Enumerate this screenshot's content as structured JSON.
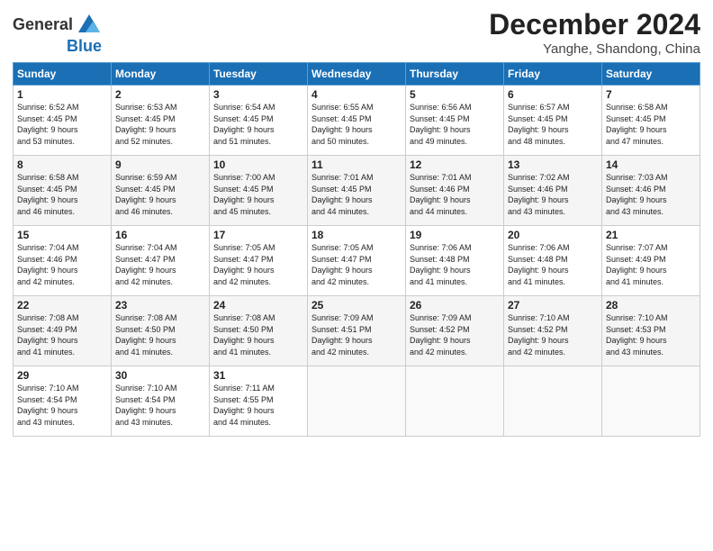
{
  "header": {
    "logo_line1": "General",
    "logo_line2": "Blue",
    "month": "December 2024",
    "location": "Yanghe, Shandong, China"
  },
  "weekdays": [
    "Sunday",
    "Monday",
    "Tuesday",
    "Wednesday",
    "Thursday",
    "Friday",
    "Saturday"
  ],
  "weeks": [
    [
      {
        "day": "1",
        "info": "Sunrise: 6:52 AM\nSunset: 4:45 PM\nDaylight: 9 hours\nand 53 minutes."
      },
      {
        "day": "2",
        "info": "Sunrise: 6:53 AM\nSunset: 4:45 PM\nDaylight: 9 hours\nand 52 minutes."
      },
      {
        "day": "3",
        "info": "Sunrise: 6:54 AM\nSunset: 4:45 PM\nDaylight: 9 hours\nand 51 minutes."
      },
      {
        "day": "4",
        "info": "Sunrise: 6:55 AM\nSunset: 4:45 PM\nDaylight: 9 hours\nand 50 minutes."
      },
      {
        "day": "5",
        "info": "Sunrise: 6:56 AM\nSunset: 4:45 PM\nDaylight: 9 hours\nand 49 minutes."
      },
      {
        "day": "6",
        "info": "Sunrise: 6:57 AM\nSunset: 4:45 PM\nDaylight: 9 hours\nand 48 minutes."
      },
      {
        "day": "7",
        "info": "Sunrise: 6:58 AM\nSunset: 4:45 PM\nDaylight: 9 hours\nand 47 minutes."
      }
    ],
    [
      {
        "day": "8",
        "info": "Sunrise: 6:58 AM\nSunset: 4:45 PM\nDaylight: 9 hours\nand 46 minutes."
      },
      {
        "day": "9",
        "info": "Sunrise: 6:59 AM\nSunset: 4:45 PM\nDaylight: 9 hours\nand 46 minutes."
      },
      {
        "day": "10",
        "info": "Sunrise: 7:00 AM\nSunset: 4:45 PM\nDaylight: 9 hours\nand 45 minutes."
      },
      {
        "day": "11",
        "info": "Sunrise: 7:01 AM\nSunset: 4:45 PM\nDaylight: 9 hours\nand 44 minutes."
      },
      {
        "day": "12",
        "info": "Sunrise: 7:01 AM\nSunset: 4:46 PM\nDaylight: 9 hours\nand 44 minutes."
      },
      {
        "day": "13",
        "info": "Sunrise: 7:02 AM\nSunset: 4:46 PM\nDaylight: 9 hours\nand 43 minutes."
      },
      {
        "day": "14",
        "info": "Sunrise: 7:03 AM\nSunset: 4:46 PM\nDaylight: 9 hours\nand 43 minutes."
      }
    ],
    [
      {
        "day": "15",
        "info": "Sunrise: 7:04 AM\nSunset: 4:46 PM\nDaylight: 9 hours\nand 42 minutes."
      },
      {
        "day": "16",
        "info": "Sunrise: 7:04 AM\nSunset: 4:47 PM\nDaylight: 9 hours\nand 42 minutes."
      },
      {
        "day": "17",
        "info": "Sunrise: 7:05 AM\nSunset: 4:47 PM\nDaylight: 9 hours\nand 42 minutes."
      },
      {
        "day": "18",
        "info": "Sunrise: 7:05 AM\nSunset: 4:47 PM\nDaylight: 9 hours\nand 42 minutes."
      },
      {
        "day": "19",
        "info": "Sunrise: 7:06 AM\nSunset: 4:48 PM\nDaylight: 9 hours\nand 41 minutes."
      },
      {
        "day": "20",
        "info": "Sunrise: 7:06 AM\nSunset: 4:48 PM\nDaylight: 9 hours\nand 41 minutes."
      },
      {
        "day": "21",
        "info": "Sunrise: 7:07 AM\nSunset: 4:49 PM\nDaylight: 9 hours\nand 41 minutes."
      }
    ],
    [
      {
        "day": "22",
        "info": "Sunrise: 7:08 AM\nSunset: 4:49 PM\nDaylight: 9 hours\nand 41 minutes."
      },
      {
        "day": "23",
        "info": "Sunrise: 7:08 AM\nSunset: 4:50 PM\nDaylight: 9 hours\nand 41 minutes."
      },
      {
        "day": "24",
        "info": "Sunrise: 7:08 AM\nSunset: 4:50 PM\nDaylight: 9 hours\nand 41 minutes."
      },
      {
        "day": "25",
        "info": "Sunrise: 7:09 AM\nSunset: 4:51 PM\nDaylight: 9 hours\nand 42 minutes."
      },
      {
        "day": "26",
        "info": "Sunrise: 7:09 AM\nSunset: 4:52 PM\nDaylight: 9 hours\nand 42 minutes."
      },
      {
        "day": "27",
        "info": "Sunrise: 7:10 AM\nSunset: 4:52 PM\nDaylight: 9 hours\nand 42 minutes."
      },
      {
        "day": "28",
        "info": "Sunrise: 7:10 AM\nSunset: 4:53 PM\nDaylight: 9 hours\nand 43 minutes."
      }
    ],
    [
      {
        "day": "29",
        "info": "Sunrise: 7:10 AM\nSunset: 4:54 PM\nDaylight: 9 hours\nand 43 minutes."
      },
      {
        "day": "30",
        "info": "Sunrise: 7:10 AM\nSunset: 4:54 PM\nDaylight: 9 hours\nand 43 minutes."
      },
      {
        "day": "31",
        "info": "Sunrise: 7:11 AM\nSunset: 4:55 PM\nDaylight: 9 hours\nand 44 minutes."
      },
      {
        "day": "",
        "info": ""
      },
      {
        "day": "",
        "info": ""
      },
      {
        "day": "",
        "info": ""
      },
      {
        "day": "",
        "info": ""
      }
    ]
  ]
}
